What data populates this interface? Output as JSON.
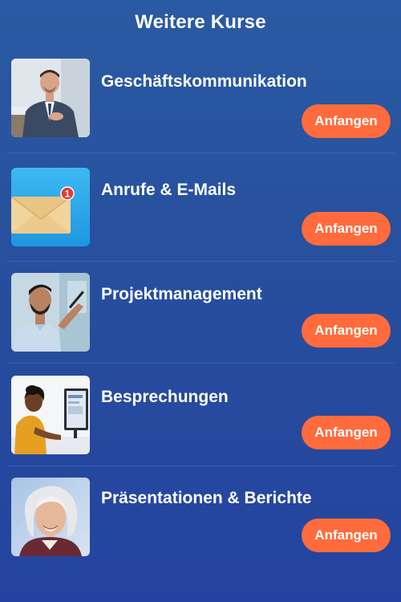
{
  "header": {
    "title": "Weitere Kurse"
  },
  "courses": [
    {
      "title": "Geschäftskommunikation",
      "button_label": "Anfangen",
      "image": "businessman-in-suit-photo"
    },
    {
      "title": "Anrufe & E-Mails",
      "button_label": "Anfangen",
      "image": "envelope-with-notification-icon",
      "badge": "1"
    },
    {
      "title": "Projektmanagement",
      "button_label": "Anfangen",
      "image": "man-writing-on-glass-photo"
    },
    {
      "title": "Besprechungen",
      "button_label": "Anfangen",
      "image": "woman-at-computer-photo"
    },
    {
      "title": "Präsentationen & Berichte",
      "button_label": "Anfangen",
      "image": "smiling-older-woman-photo"
    }
  ],
  "colors": {
    "background_top": "#2a5aa3",
    "background_bottom": "#2443a0",
    "button": "#ff6b3d",
    "text": "#ffffff"
  }
}
